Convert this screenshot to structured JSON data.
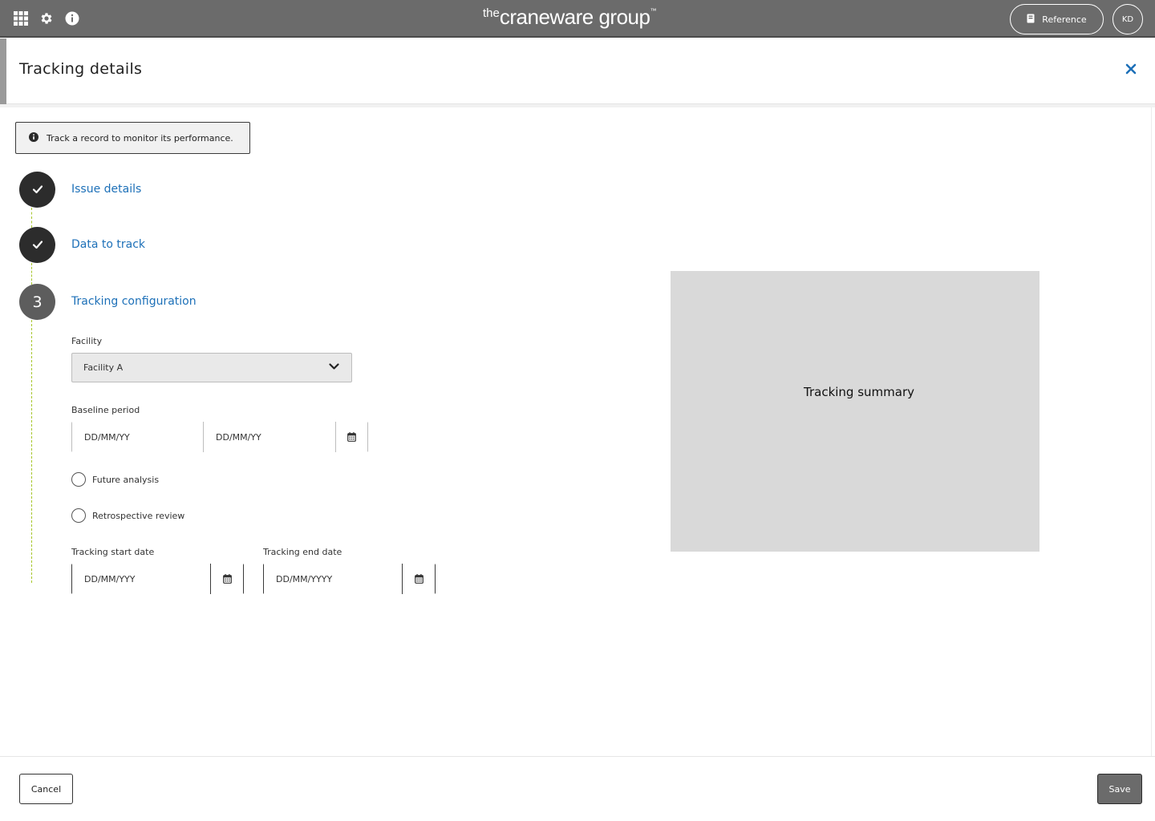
{
  "topbar": {
    "brand_the": "the",
    "brand_main": "craneware group",
    "brand_tm": "™",
    "reference_label": "Reference",
    "avatar_initials": "KD",
    "icons": [
      "apps-grid-icon",
      "gear-icon",
      "info-icon"
    ]
  },
  "header": {
    "title": "Tracking details"
  },
  "info_banner": {
    "text": "Track a record to monitor its performance."
  },
  "steps": [
    {
      "label": "Issue details",
      "status": "complete"
    },
    {
      "label": "Data to track",
      "status": "complete"
    },
    {
      "label": "Tracking configuration",
      "status": "current",
      "number": "3"
    }
  ],
  "form": {
    "facility_label": "Facility",
    "facility_value": "Facility A",
    "baseline_label": "Baseline period",
    "baseline_start_placeholder": "DD/MM/YY",
    "baseline_end_placeholder": "DD/MM/YY",
    "radio_future": "Future analysis",
    "radio_retro": "Retrospective review",
    "tracking_start_label": "Tracking start date",
    "tracking_start_placeholder": "DD/MM/YYY",
    "tracking_end_label": "Tracking end date",
    "tracking_end_placeholder": "DD/MM/YYYY"
  },
  "summary": {
    "title": "Tracking summary"
  },
  "footer": {
    "cancel_label": "Cancel",
    "save_label": "Save"
  },
  "colors": {
    "topbar": "#6b6b6b",
    "link_blue": "#1d70b8",
    "step_line": "#a7c62c",
    "summary_bg": "#d9d9d9"
  }
}
